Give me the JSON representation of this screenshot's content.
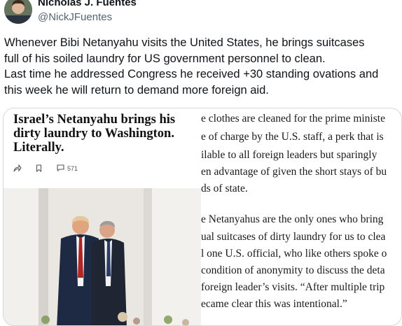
{
  "author": {
    "name": "Nicholas J. Fuentes",
    "handle": "@NickJFuentes"
  },
  "tweet": {
    "lines": [
      "Whenever Bibi Netanyahu visits the United States, he brings suitcases",
      "full of his soiled laundry for US government personnel to clean.",
      "Last time he addressed Congress he received +30 standing ovations and",
      "this week he will return to demand more foreign aid."
    ]
  },
  "article": {
    "headline_lines": [
      "Israel’s Netanyahu brings his",
      "dirty laundry to Washington.",
      "Literally."
    ],
    "actions": {
      "share_icon": "share-arrow-icon",
      "bookmark_icon": "bookmark-icon",
      "comment_icon": "comment-icon",
      "comment_count": "571"
    },
    "body_lines": [
      "e clothes are cleaned for the prime ministe",
      "e of charge by the U.S. staff, a perk that is",
      "ilable to all foreign leaders but sparingly",
      "en advantage of given the short stays of bu",
      "ds of state.",
      "e Netanyahus are the only ones who bring",
      "ual suitcases of dirty laundry for us to clea",
      "l one U.S. official, who like others spoke o",
      "condition of anonymity to discuss the deta",
      "foreign leader’s visits. “After multiple trip",
      "ecame clear this was intentional.”"
    ]
  }
}
